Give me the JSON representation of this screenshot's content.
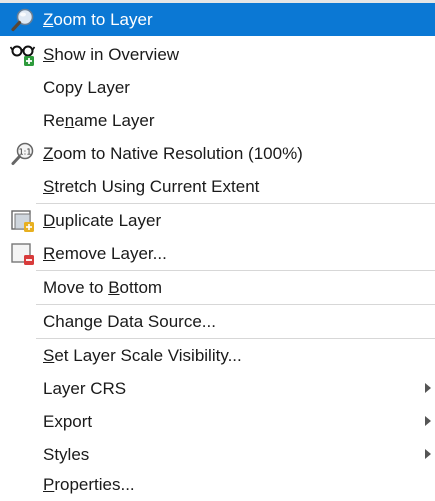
{
  "menu": {
    "items": [
      {
        "pre": "",
        "acc": "Z",
        "post": "oom to Layer",
        "icon": "zoom-to-layer-icon"
      },
      {
        "pre": "",
        "acc": "S",
        "post": "how in Overview",
        "icon": "show-in-overview-icon"
      },
      {
        "pre": "Copy Layer",
        "acc": "",
        "post": ""
      },
      {
        "pre": "Re",
        "acc": "n",
        "post": "ame Layer"
      },
      {
        "pre": "",
        "acc": "Z",
        "post": "oom to Native Resolution (100%)",
        "icon": "zoom-native-resolution-icon"
      },
      {
        "pre": "",
        "acc": "S",
        "post": "tretch Using Current Extent"
      },
      {
        "pre": "",
        "acc": "D",
        "post": "uplicate Layer",
        "icon": "duplicate-layer-icon"
      },
      {
        "pre": "",
        "acc": "R",
        "post": "emove Layer...",
        "icon": "remove-layer-icon"
      },
      {
        "pre": "Move to ",
        "acc": "B",
        "post": "ottom"
      },
      {
        "pre": "Change Data Source...",
        "acc": "",
        "post": ""
      },
      {
        "pre": "",
        "acc": "S",
        "post": "et Layer Scale Visibility..."
      },
      {
        "pre": "Layer CRS",
        "acc": "",
        "post": "",
        "submenu": true
      },
      {
        "pre": "Export",
        "acc": "",
        "post": "",
        "submenu": true
      },
      {
        "pre": "Styles",
        "acc": "",
        "post": "",
        "submenu": true
      },
      {
        "pre": "",
        "acc": "P",
        "post": "roperties..."
      }
    ]
  },
  "colors": {
    "highlight": "#0b78d4",
    "text": "#1a1a1a",
    "separator": "#d7d7d7"
  }
}
